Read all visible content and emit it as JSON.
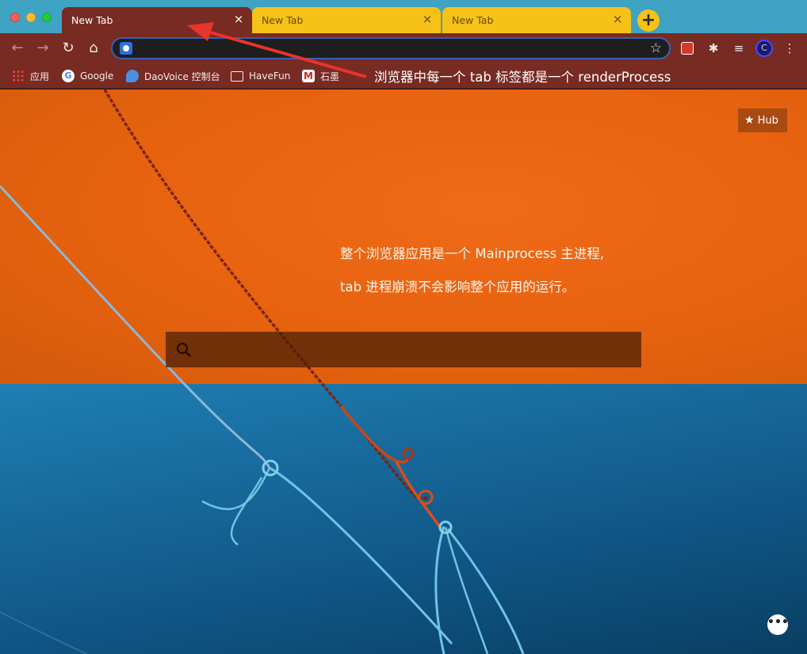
{
  "window": {
    "traffic_lights": [
      "close",
      "minimize",
      "zoom"
    ]
  },
  "tabs": [
    {
      "title": "New Tab",
      "active": true,
      "close_glyph": "×"
    },
    {
      "title": "New Tab",
      "active": false,
      "close_glyph": "×"
    },
    {
      "title": "New Tab",
      "active": false,
      "close_glyph": "×"
    }
  ],
  "new_tab_glyph": "+",
  "toolbar": {
    "back_glyph": "←",
    "forward_glyph": "→",
    "reload_glyph": "↻",
    "home_glyph": "⌂",
    "address_value": "",
    "star_glyph": "☆",
    "extensions_glyph": "✱",
    "media_glyph": "≡",
    "profile_initial": "C",
    "menu_glyph": "⋮"
  },
  "bookmarks": [
    {
      "label": "应用",
      "icon": "apps-grid-icon"
    },
    {
      "label": "Google",
      "icon": "google-icon"
    },
    {
      "label": "DaoVoice 控制台",
      "icon": "daovoice-icon"
    },
    {
      "label": "HaveFun",
      "icon": "folder-icon"
    },
    {
      "label": "石墨",
      "icon": "m-logo-icon"
    }
  ],
  "annotation": {
    "text": "浏览器中每一个 tab 标签都是一个 renderProcess",
    "color": "#e8342c"
  },
  "page": {
    "hub_label": "Hub",
    "hero_line1": "整个浏览器应用是一个 Mainprocess 主进程,",
    "hero_line2": "tab 进程崩溃不会影响整个应用的运行。",
    "search_value": "",
    "chat_glyph": "•••"
  },
  "colors": {
    "accent": "#772b23",
    "tab_inactive": "#f6c218",
    "orange_bg": "#e6620f",
    "blue_bg": "#17689a"
  }
}
